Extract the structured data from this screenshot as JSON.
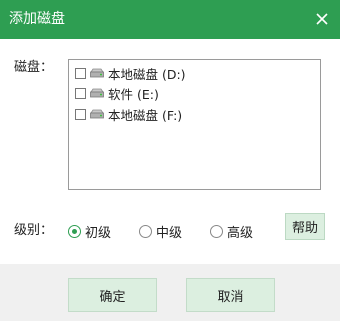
{
  "window": {
    "title": "添加磁盘",
    "accent": "#2e9e52"
  },
  "disks": {
    "label": "磁盘：",
    "items": [
      {
        "label": "本地磁盘 (D:)",
        "checked": false
      },
      {
        "label": "软件 (E:)",
        "checked": false
      },
      {
        "label": "本地磁盘 (F:)",
        "checked": false
      }
    ]
  },
  "level": {
    "label": "级别：",
    "options": [
      {
        "label": "初级",
        "selected": true
      },
      {
        "label": "中级",
        "selected": false
      },
      {
        "label": "高级",
        "selected": false
      }
    ],
    "help_label": "帮助"
  },
  "footer": {
    "ok_label": "确定",
    "cancel_label": "取消"
  },
  "icons": {
    "close": "close-icon",
    "drive": "hard-drive-icon"
  }
}
